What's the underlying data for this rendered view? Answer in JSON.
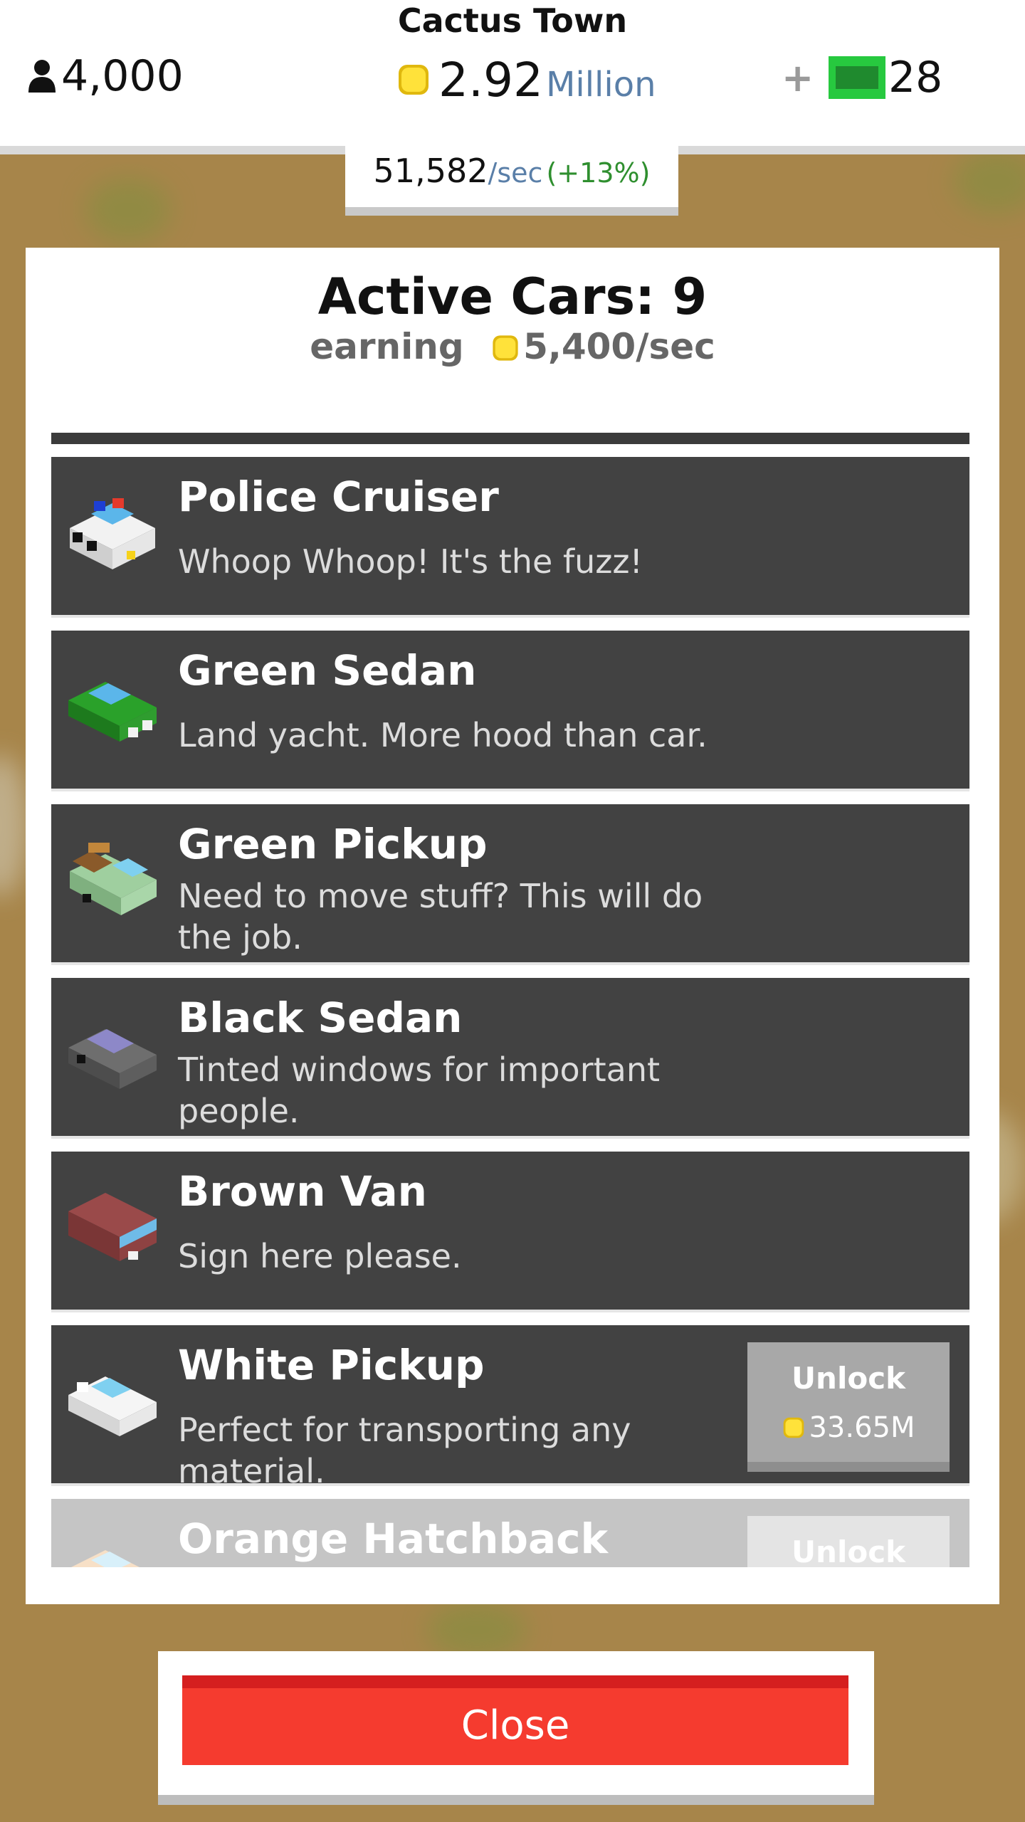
{
  "header": {
    "town_name": "Cactus Town",
    "population": "4,000",
    "money_value": "2.92",
    "money_unit": "Million",
    "plus_label": "+",
    "cash_count": "28",
    "rate_value": "51,582",
    "rate_unit": "/sec",
    "rate_bonus": "(+13%)"
  },
  "panel": {
    "title": "Active Cars: 9",
    "earning_label": "earning",
    "earning_value": "5,400/sec"
  },
  "cars": [
    {
      "name": "Police Cruiser",
      "desc": "Whoop Whoop! It's the fuzz!",
      "icon": "police-cruiser-icon"
    },
    {
      "name": "Green Sedan",
      "desc": "Land yacht. More hood than car.",
      "icon": "green-sedan-icon"
    },
    {
      "name": "Green Pickup",
      "desc": "Need to move stuff? This will do the job.",
      "icon": "green-pickup-icon"
    },
    {
      "name": "Black Sedan",
      "desc": "Tinted windows for important people.",
      "icon": "black-sedan-icon"
    },
    {
      "name": "Brown Van",
      "desc": "Sign here please.",
      "icon": "brown-van-icon"
    },
    {
      "name": "White Pickup",
      "desc": "Perfect for transporting any material.",
      "icon": "white-pickup-icon",
      "unlock_label": "Unlock",
      "unlock_cost": "33.65M"
    },
    {
      "name": "Orange Hatchback",
      "desc": "",
      "icon": "orange-hatchback-icon",
      "unlock_label": "Unlock"
    }
  ],
  "close_label": "Close",
  "colors": {
    "background": "#a7854a",
    "card": "#424242",
    "close_button": "#f53b2f",
    "accent_blue": "#5a7fa8",
    "bonus_green": "#2f8f2f",
    "coin": "#f7d21c"
  }
}
